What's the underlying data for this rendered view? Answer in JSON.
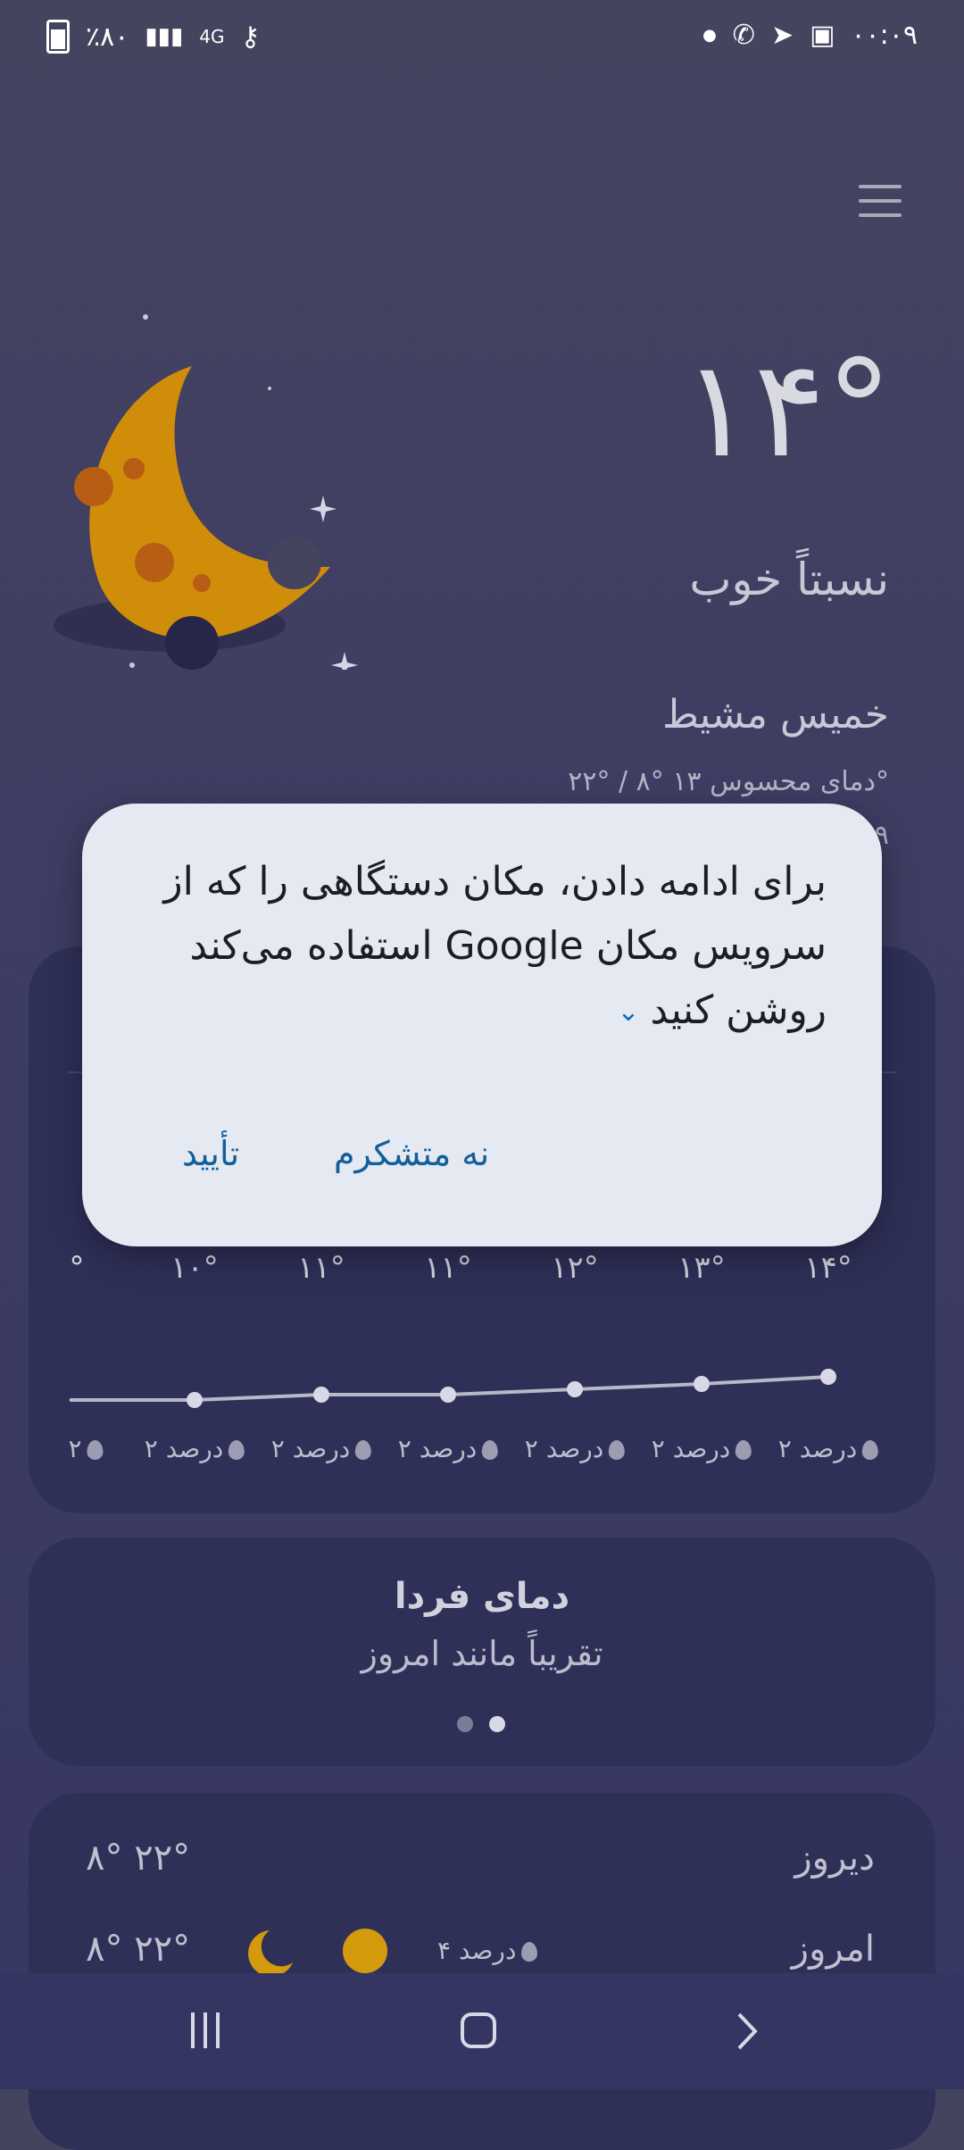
{
  "status_bar": {
    "battery_text": "٪۸۰",
    "network": "4G",
    "time": "۰۰:۰۹"
  },
  "weather": {
    "temperature": "۱۴°",
    "condition": "نسبتاً خوب",
    "location": "خمیس مشیط",
    "min_max_feels": "۲۲° / ۸° دمای محسوس ۱۳°",
    "extra_line": "۹"
  },
  "hourly": {
    "temps": [
      "۱۴°",
      "۱۳°",
      "۱۲°",
      "۱۱°",
      "۱۱°",
      "۱۰°",
      "°"
    ],
    "rain": [
      "۲ درصد",
      "۲ درصد",
      "۲ درصد",
      "۲ درصد",
      "۲ درصد",
      "۲ درصد",
      "۲"
    ]
  },
  "tomorrow": {
    "title": "دمای فردا",
    "subtitle": "تقریباً مانند امروز"
  },
  "daily": {
    "yesterday_label": "دیروز",
    "yesterday_temps": "۸° ۲۲°",
    "today_label": "امروز",
    "today_rain": "۴ درصد",
    "today_temps": "۸° ۲۲°"
  },
  "dialog": {
    "message": "برای ادامه دادن، مکان دستگاهی را که از سرویس مکان Google استفاده می‌کند روشن کنید",
    "cancel_label": "نه متشکرم",
    "confirm_label": "تأیید"
  },
  "colors": {
    "background": "#3e3d63",
    "card": "#2f3058",
    "dialog": "#e4e9f2",
    "accent_button": "#145f9a",
    "moon": "#d39a0c"
  }
}
